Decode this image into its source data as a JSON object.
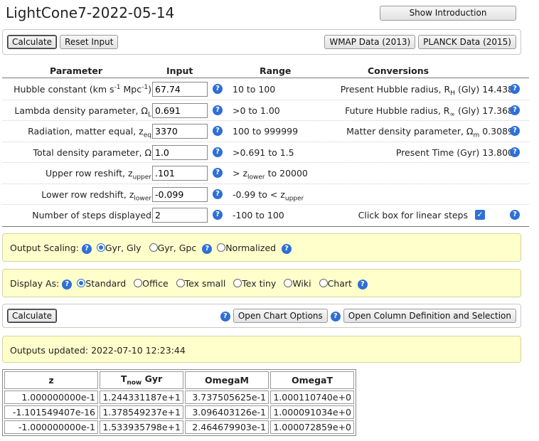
{
  "app": {
    "title": "LightCone7-2022-05-14",
    "intro_button": "Show Introduction"
  },
  "toolbar": {
    "calculate": "Calculate",
    "reset": "Reset Input",
    "wmap": "WMAP Data (2013)",
    "planck": "PLANCK Data (2015)"
  },
  "table_header": {
    "parameter": "Parameter",
    "input": "Input",
    "range": "Range",
    "conversions": "Conversions"
  },
  "params": [
    {
      "label": "Hubble constant (km s",
      "label_sup1": "-1",
      "label_mid": " Mpc",
      "label_sup2": "-1",
      "label_end": ")",
      "value": "67.74",
      "range": "10 to 100",
      "conv_label": "Present Hubble radius, R",
      "conv_sub": "H",
      "conv_end": " (Gly)",
      "conv_value": "14.438"
    },
    {
      "label": "Lambda density parameter, Ω",
      "label_sub": "L",
      "value": "0.691",
      "range": ">0 to 1.00",
      "conv_label": "Future Hubble radius, R",
      "conv_sub": "∞",
      "conv_end": " (Gly)",
      "conv_value": "17.368"
    },
    {
      "label": "Radiation, matter equal, z",
      "label_sub": "eq",
      "value": "3370",
      "range": "100 to 999999",
      "conv_label": "Matter density parameter, Ω",
      "conv_sub": "m",
      "conv_value": "0.3089"
    },
    {
      "label": "Total density parameter, Ω",
      "value": "1.0",
      "range": ">0.691 to 1.5",
      "conv_label": "Present Time (Gyr)",
      "conv_value": "13.800"
    },
    {
      "label": "Upper row reshift, z",
      "label_sub": "upper",
      "value": ".101",
      "range_pre": "> z",
      "range_sub": "lower",
      "range_post": " to 20000"
    },
    {
      "label": "Lower row redshift, z",
      "label_sub": "lower",
      "value": "-0.099",
      "range_pre": "-0.99 to < z",
      "range_sub": "upper"
    },
    {
      "label": "Number of steps displayed",
      "value": "2",
      "range": "-100 to 100",
      "conv_label": "Click box for linear steps"
    }
  ],
  "scaling": {
    "label": "Output Scaling:",
    "options": [
      "Gyr, Gly",
      "Gyr, Gpc",
      "Normalized"
    ],
    "selected": "Gyr, Gly"
  },
  "display": {
    "label": "Display As:",
    "options": [
      "Standard",
      "Office",
      "Tex small",
      "Tex tiny",
      "Wiki",
      "Chart"
    ],
    "selected": "Standard"
  },
  "calc_bar": {
    "calculate": "Calculate",
    "chart_options": "Open Chart Options",
    "column_def": "Open Column Definition and Selection"
  },
  "status": {
    "text": "Outputs updated: 2022-07-10 12:23:44"
  },
  "results": {
    "headers": [
      "z",
      "T",
      "now",
      " Gyr",
      "OmegaM",
      "OmegaT"
    ],
    "rows": [
      [
        "1.000000000e-1",
        "1.244331187e+1",
        "3.737505625e-1",
        "1.000110740e+0"
      ],
      [
        "-1.101549407e-16",
        "1.378549237e+1",
        "3.096403126e-1",
        "1.000091034e+0"
      ],
      [
        "-1.000000000e-1",
        "1.533935798e+1",
        "2.464679903e-1",
        "1.000072859e+0"
      ]
    ]
  },
  "icons": {
    "help": "?",
    "check": "✓"
  },
  "colors": {
    "accent": "#2f6fd6",
    "panel_yellow": "#ffffcc"
  }
}
